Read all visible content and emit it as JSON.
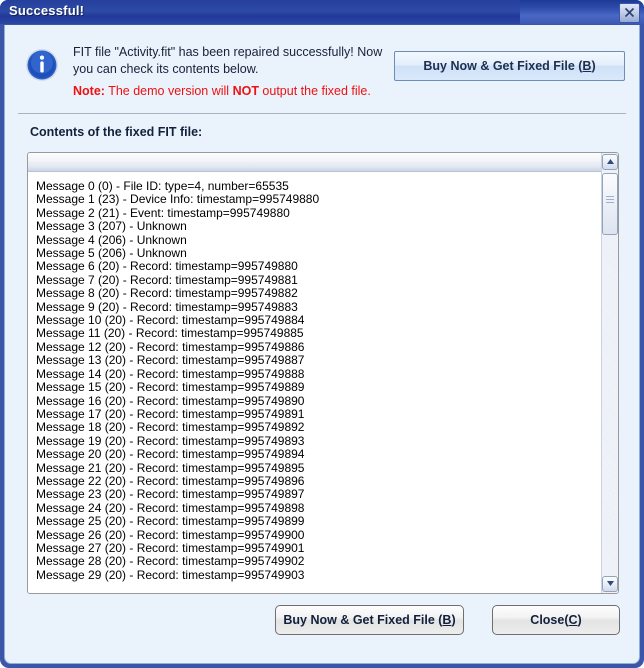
{
  "window": {
    "title": "Successful!",
    "close_icon": "close-icon"
  },
  "header": {
    "info_icon": "info-icon",
    "message": "FIT file \"Activity.fit\" has been repaired successfully! Now you can check its contents below.",
    "note_label": "Note:",
    "note_text_1": " The demo version will ",
    "note_emphasis": "NOT",
    "note_text_2": " output the fixed file.",
    "note_color": "#ee1111",
    "buy_button_pre": "Buy Now & Get Fixed File (",
    "buy_button_key": "B",
    "buy_button_post": ")"
  },
  "contents": {
    "label": "Contents of the fixed FIT file:",
    "rows": [
      "Message 0 (0) - File ID: type=4, number=65535",
      "Message 1 (23) - Device Info: timestamp=995749880",
      "Message 2 (21) - Event: timestamp=995749880",
      "Message 3 (207) - Unknown",
      "Message 4 (206) - Unknown",
      "Message 5 (206) - Unknown",
      "Message 6 (20) - Record: timestamp=995749880",
      "Message 7 (20) - Record: timestamp=995749881",
      "Message 8 (20) - Record: timestamp=995749882",
      "Message 9 (20) - Record: timestamp=995749883",
      "Message 10 (20) - Record: timestamp=995749884",
      "Message 11 (20) - Record: timestamp=995749885",
      "Message 12 (20) - Record: timestamp=995749886",
      "Message 13 (20) - Record: timestamp=995749887",
      "Message 14 (20) - Record: timestamp=995749888",
      "Message 15 (20) - Record: timestamp=995749889",
      "Message 16 (20) - Record: timestamp=995749890",
      "Message 17 (20) - Record: timestamp=995749891",
      "Message 18 (20) - Record: timestamp=995749892",
      "Message 19 (20) - Record: timestamp=995749893",
      "Message 20 (20) - Record: timestamp=995749894",
      "Message 21 (20) - Record: timestamp=995749895",
      "Message 22 (20) - Record: timestamp=995749896",
      "Message 23 (20) - Record: timestamp=995749897",
      "Message 24 (20) - Record: timestamp=995749898",
      "Message 25 (20) - Record: timestamp=995749899",
      "Message 26 (20) - Record: timestamp=995749900",
      "Message 27 (20) - Record: timestamp=995749901",
      "Message 28 (20) - Record: timestamp=995749902",
      "Message 29 (20) - Record: timestamp=995749903"
    ],
    "scroll_up_icon": "scroll-up-arrow-icon",
    "scroll_down_icon": "scroll-down-arrow-icon"
  },
  "footer": {
    "buy_button_pre": "Buy Now & Get Fixed File (",
    "buy_button_key": "B",
    "buy_button_post": ")",
    "close_button_pre": "Close(",
    "close_button_key": "C",
    "close_button_post": ")"
  },
  "colors": {
    "titlebar": "#24409c",
    "client_background": "#eaf3fc",
    "accent_blue": "#3b55a8",
    "note_red": "#ee1111",
    "list_background": "#ffffff"
  }
}
